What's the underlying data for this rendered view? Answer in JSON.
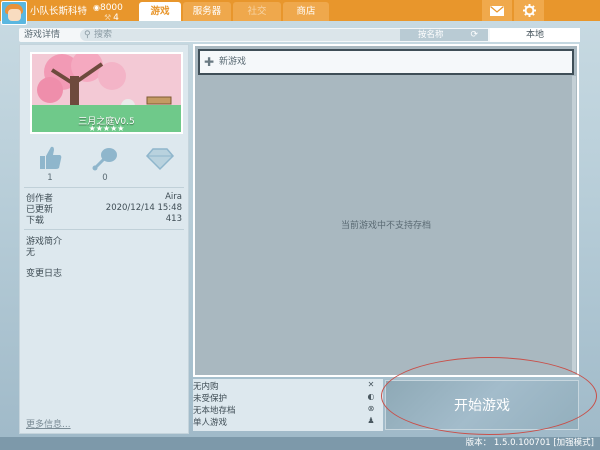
{
  "header": {
    "user_name": "小队长斯科特",
    "coins": "8000",
    "level": "4",
    "tabs": [
      {
        "label": "游戏",
        "state": "active"
      },
      {
        "label": "服务器",
        "state": "normal"
      },
      {
        "label": "社交",
        "state": "disabled"
      },
      {
        "label": "商店",
        "state": "normal"
      }
    ],
    "icons": [
      "mail-icon",
      "gear-icon"
    ]
  },
  "subheader": {
    "title": "游戏详情",
    "search_placeholder": "搜索",
    "sort_label": "按名称",
    "local_tab": "本地"
  },
  "game": {
    "thumbnail_title": "三月之庭V0.5",
    "stars": "★★★★★",
    "likes": "1",
    "favorites": "0",
    "author_label": "创作者",
    "author": "Aira",
    "updated_label": "已更新",
    "updated": "2020/12/14 15:48",
    "downloads_label": "下载",
    "downloads": "413",
    "intro_label": "游戏简介",
    "intro": "无",
    "changelog_label": "变更日志",
    "more_link": "更多信息..."
  },
  "main": {
    "new_game_label": "新游戏",
    "no_save_message": "当前游戏中不支持存档"
  },
  "info": {
    "items": [
      "无内购",
      "未受保护",
      "无本地存档",
      "单人游戏"
    ]
  },
  "start_button": "开始游戏",
  "footer": {
    "version": "版本： 1.5.0.100701 [加强模式]"
  },
  "colors": {
    "accent": "#e8962c",
    "panel": "#dde8ee",
    "annotation": "#c8504a"
  }
}
